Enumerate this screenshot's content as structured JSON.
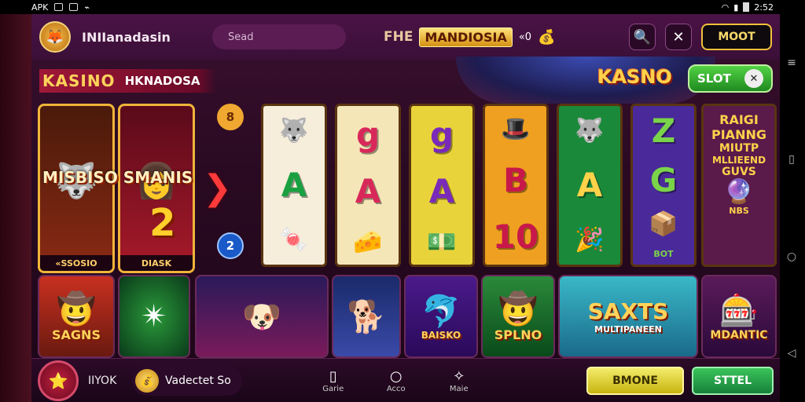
{
  "status_bar": {
    "left_text": "APK",
    "time": "2:52"
  },
  "header": {
    "logo_icon": "🦊",
    "brand": "INIIanadasin",
    "search_placeholder": "Sead",
    "banner": {
      "pre": "FHE",
      "gold": "MANDIOSIA",
      "post": "«0",
      "chest_icon": "💰"
    },
    "search_icon": "🔍",
    "tools_icon": "✕",
    "moot_label": "MOOT"
  },
  "section": {
    "title_main": "KASINO",
    "title_sub": "HKNADOSA"
  },
  "casino_badge": "KASNO",
  "slot_button": {
    "label": "SLOT",
    "icon": "✕"
  },
  "arrows": {
    "left": "❮",
    "right": "❯"
  },
  "featured": {
    "overlay_title": "MISBISO SMANIS",
    "big_number": "2",
    "cards": [
      {
        "art": "🐺",
        "caption": "«SSOSIO"
      },
      {
        "art": "👩",
        "caption": "DIASK"
      }
    ],
    "badges": [
      "8",
      "2"
    ]
  },
  "reels": [
    {
      "top": "🐺",
      "mid": "A",
      "bot": "🍬",
      "cap": "",
      "bg": "#f6eedb",
      "color": "#1aa040"
    },
    {
      "top": "g",
      "mid": "A",
      "bot": "🧀",
      "cap": "",
      "bg": "#f5e6b8",
      "color": "#d8285a"
    },
    {
      "top": "g",
      "mid": "A",
      "bot": "💵",
      "cap": "",
      "bg": "#e8d43a",
      "color": "#7a2ab8"
    },
    {
      "top": "🎩",
      "mid": "B",
      "bot": "10",
      "cap": "",
      "bg": "#f0a020",
      "color": "#c8184a"
    },
    {
      "top": "🐺",
      "mid": "A",
      "bot": "🎉",
      "cap": "",
      "bg": "#1a8a3a",
      "color": "#ffd24a"
    },
    {
      "top": "Z",
      "mid": "G",
      "bot": "📦",
      "cap": "BOT",
      "bg": "#4a2a9a",
      "color": "#7ad44a"
    },
    {
      "top": "",
      "mid": "",
      "bot": "🔮",
      "cap": "NBS",
      "bg": "#5a1a4a",
      "color": "#ffd24a",
      "text_lines": [
        "RAIGI",
        "PIANNG",
        "MIUTP",
        "MLLIEEND",
        "GUVS"
      ]
    }
  ],
  "tiles": [
    {
      "icon": "🤠",
      "label": "SAGNS",
      "bg": "linear-gradient(#c83020,#6a1a10)"
    },
    {
      "icon": "✴",
      "label": "",
      "bg": "radial-gradient(#2a9a3a,#0a3a1a)"
    },
    {
      "icon": "🐶",
      "label": "",
      "bg": "linear-gradient(#2a1a5a,#7a1a5a)"
    },
    {
      "icon": "🐕",
      "label": "",
      "bg": "linear-gradient(#1a2a6a,#3a4aa8)"
    },
    {
      "icon": "🐬",
      "label": "BAISKO",
      "bg": "linear-gradient(#4a1a8a,#2a0a5a)"
    },
    {
      "icon": "🤠",
      "label": "SPLNO",
      "bg": "linear-gradient(#2a8a3a,#0a4a1a)"
    },
    {
      "icon": "",
      "label": "SAXTS",
      "sub": "MULTIPANEEN",
      "bg": "linear-gradient(#3ab8c8,#1a6a8a)"
    },
    {
      "icon": "🎰",
      "label": "MDANTIC",
      "bg": "linear-gradient(#5a1a5a,#2a0a3a)"
    }
  ],
  "bottom": {
    "avatar_icon": "⭐",
    "name": "IIYOK",
    "wallet_icon": "💰",
    "wallet_text": "Vadectet So",
    "nav": [
      {
        "icon": "▯",
        "label": "Garie"
      },
      {
        "icon": "○",
        "label": "Acco"
      },
      {
        "icon": "✧",
        "label": "Maie"
      }
    ],
    "btn_yellow": "BMONE",
    "btn_green": "STTEL"
  },
  "colors": {
    "accent_gold": "#ffd24a",
    "brand_purple": "#3a0f38",
    "green": "#2ab84a"
  }
}
